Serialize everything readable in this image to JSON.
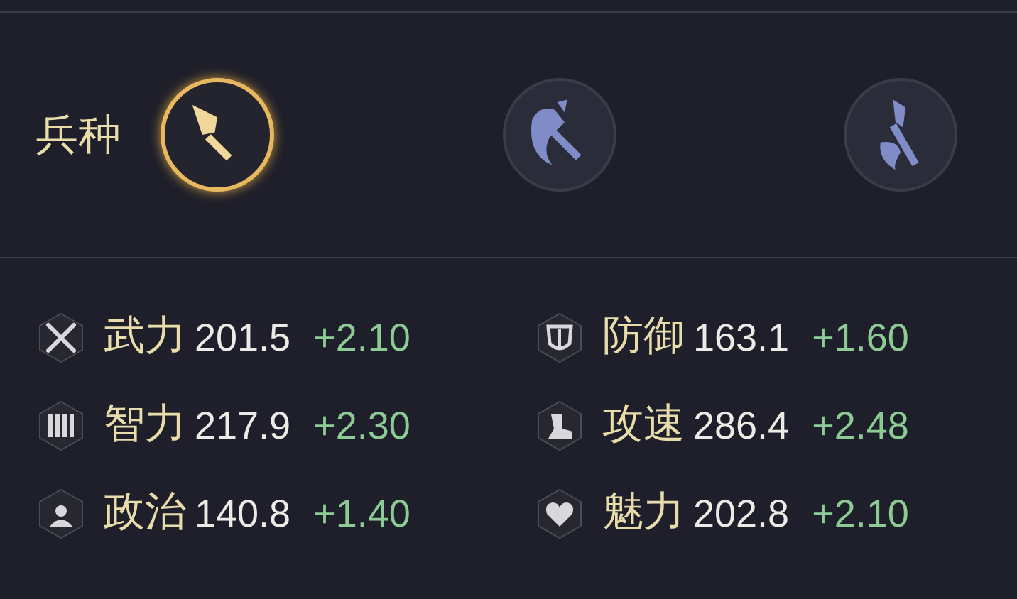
{
  "troop_type": {
    "label": "兵种",
    "options": [
      {
        "kind": "spear",
        "selected": true
      },
      {
        "kind": "axe",
        "selected": false
      },
      {
        "kind": "halberd",
        "selected": false
      }
    ]
  },
  "stats": [
    {
      "kind": "force",
      "label": "武力",
      "value": "201.5",
      "bonus": "+2.10"
    },
    {
      "kind": "defense",
      "label": "防御",
      "value": "163.1",
      "bonus": "+1.60"
    },
    {
      "kind": "intellect",
      "label": "智力",
      "value": "217.9",
      "bonus": "+2.30"
    },
    {
      "kind": "speed",
      "label": "攻速",
      "value": "286.4",
      "bonus": "+2.48"
    },
    {
      "kind": "politics",
      "label": "政治",
      "value": "140.8",
      "bonus": "+1.40"
    },
    {
      "kind": "charm",
      "label": "魅力",
      "value": "202.8",
      "bonus": "+2.10"
    }
  ]
}
